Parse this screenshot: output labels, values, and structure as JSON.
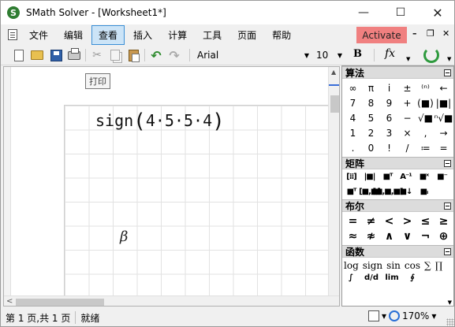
{
  "window": {
    "title": "SMath Solver - [Worksheet1*]",
    "app_icon_letter": "S",
    "controls": {
      "minimize": "—",
      "maximize": "☐",
      "close": "✕"
    }
  },
  "menubar": {
    "items": [
      "文件",
      "编辑",
      "查看",
      "插入",
      "计算",
      "工具",
      "页面",
      "帮助"
    ],
    "active_index": 2,
    "activate_label": "Activate",
    "mdi_controls": {
      "minimize": "–",
      "restore": "❐",
      "close": "✕"
    }
  },
  "toolbar": {
    "font_name": "Arial",
    "font_size": "10",
    "bold_label": "B",
    "fx_label": "fx",
    "dropdown_arrow": "▼"
  },
  "worksheet": {
    "tooltip": "打印",
    "expression": {
      "func": "sign",
      "open_paren": "(",
      "args": "4·5·5·4",
      "close_paren": ")"
    },
    "greek": "β",
    "scroll_left": "<",
    "scroll_up": "▲"
  },
  "panel": {
    "sections": {
      "arithmetic": {
        "title": "算法",
        "symbols": [
          "∞",
          "π",
          "i",
          "±",
          "⁽ⁿ⁾",
          "←",
          "7",
          "8",
          "9",
          "+",
          "(■)",
          "|■|",
          "4",
          "5",
          "6",
          "−",
          "√■",
          "ⁿ√■",
          "1",
          "2",
          "3",
          "×",
          ",",
          "→",
          ".",
          "0",
          "!",
          "/",
          "≔",
          "="
        ]
      },
      "matrix": {
        "title": "矩阵",
        "items": [
          "[⁞⁞]",
          "|■|",
          "■ᵀ",
          "A⁻¹",
          "■ˣ",
          "■⁻",
          "■ᵀ",
          "[■,■]",
          "[■,■,■]",
          "■↓",
          "■ᵢ"
        ]
      },
      "boolean": {
        "title": "布尔",
        "symbols": [
          "=",
          "≠",
          "<",
          ">",
          "≤",
          "≥",
          "≈",
          "≉",
          "∧",
          "∨",
          "¬",
          "⊕"
        ]
      },
      "functions": {
        "title": "函数",
        "names": [
          "log",
          "sign",
          "sin",
          "cos",
          "∑",
          "∏"
        ],
        "more_icons": [
          "∫",
          "d/d",
          "lim",
          "∮"
        ]
      }
    }
  },
  "statusbar": {
    "page_info": "第 1 页,共 1 页",
    "state": "就绪",
    "zoom": "170%",
    "dropdown_arrow": "▾"
  }
}
